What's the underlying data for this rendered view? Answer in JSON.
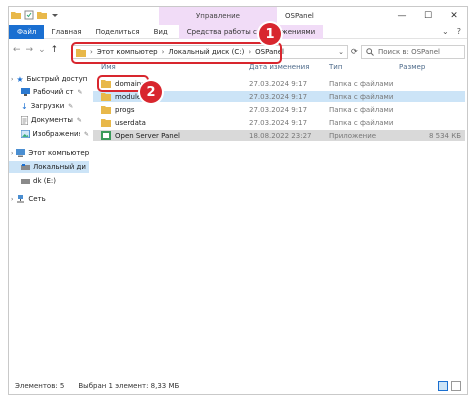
{
  "window": {
    "title": "OSPanel",
    "manage_label": "Управление",
    "minimize": "—",
    "maximize": "☐",
    "close": "✕"
  },
  "ribbon": {
    "file": "Файл",
    "home": "Главная",
    "share": "Поделиться",
    "view": "Вид",
    "app_tools": "Средства работы с приложениями",
    "collapse": "⌄",
    "help": "?"
  },
  "address": {
    "crumbs": [
      "Этот компьютер",
      "Локальный диск (C:)",
      "OSPanel"
    ],
    "search_placeholder": "Поиск в: OSPanel"
  },
  "annotations": {
    "badge1": "1",
    "badge2": "2"
  },
  "nav": {
    "quick_access": "Быстрый доступ",
    "desktop": "Рабочий ст",
    "downloads": "Загрузки",
    "documents": "Документы",
    "pictures": "Изображения",
    "this_pc": "Этот компьютер",
    "local_disk": "Локальный ди",
    "dk": "dk (E:)",
    "network": "Сеть"
  },
  "columns": {
    "name": "Имя",
    "date": "Дата изменения",
    "type": "Тип",
    "size": "Размер"
  },
  "files": [
    {
      "name": "domains",
      "date": "27.03.2024 9:17",
      "type": "Папка с файлами",
      "size": ""
    },
    {
      "name": "modules",
      "date": "27.03.2024 9:17",
      "type": "Папка с файлами",
      "size": ""
    },
    {
      "name": "progs",
      "date": "27.03.2024 9:17",
      "type": "Папка с файлами",
      "size": ""
    },
    {
      "name": "userdata",
      "date": "27.03.2024 9:17",
      "type": "Папка с файлами",
      "size": ""
    },
    {
      "name": "Open Server Panel",
      "date": "18.08.2022 23:27",
      "type": "Приложение",
      "size": "8 534 КБ"
    }
  ],
  "status": {
    "items": "Элементов: 5",
    "selected": "Выбран 1 элемент: 8,33 МБ"
  },
  "colors": {
    "accent": "#1a6fd1",
    "annotation": "#d8262e",
    "tools_band": "#f1dcf7",
    "folder": "#e8b84a"
  }
}
